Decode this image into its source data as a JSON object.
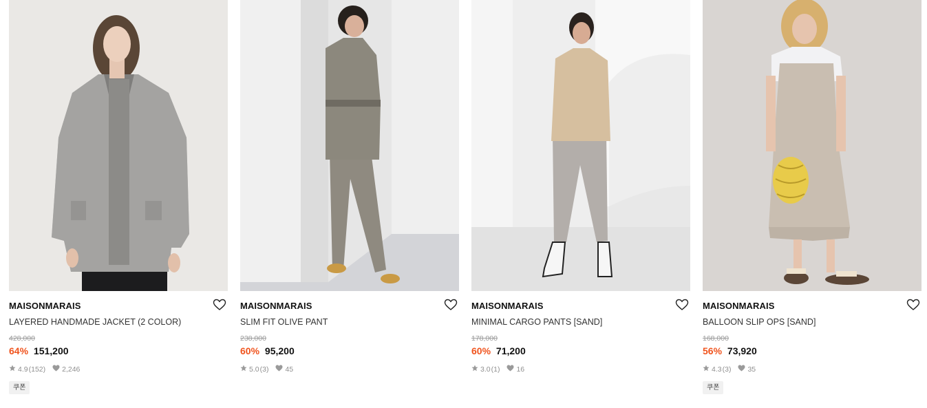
{
  "products": [
    {
      "brand": "MAISONMARAIS",
      "name": "LAYERED HANDMADE JACKET (2 COLOR)",
      "original_price": "428,000",
      "discount": "64%",
      "price": "151,200",
      "rating": "4.9",
      "review_count": "(152)",
      "likes": "2,246",
      "coupon": "쿠폰",
      "photo_bg": "#ecebe9"
    },
    {
      "brand": "MAISONMARAIS",
      "name": "SLIM FIT OLIVE PANT",
      "original_price": "238,000",
      "discount": "60%",
      "price": "95,200",
      "rating": "5.0",
      "review_count": "(3)",
      "likes": "45",
      "photo_bg": "#e6e6e6"
    },
    {
      "brand": "MAISONMARAIS",
      "name": "MINIMAL CARGO PANTS [SAND]",
      "original_price": "178,000",
      "discount": "60%",
      "price": "71,200",
      "rating": "3.0",
      "review_count": "(1)",
      "likes": "16",
      "photo_bg": "#eeeeee"
    },
    {
      "brand": "MAISONMARAIS",
      "name": "BALLOON SLIP OPS [SAND]",
      "original_price": "168,000",
      "discount": "56%",
      "price": "73,920",
      "rating": "4.3",
      "review_count": "(3)",
      "likes": "35",
      "coupon": "쿠폰",
      "photo_bg": "#d9d5d2"
    }
  ],
  "colors": {
    "discount": "#f0541e",
    "muted": "#8f8f8f"
  }
}
